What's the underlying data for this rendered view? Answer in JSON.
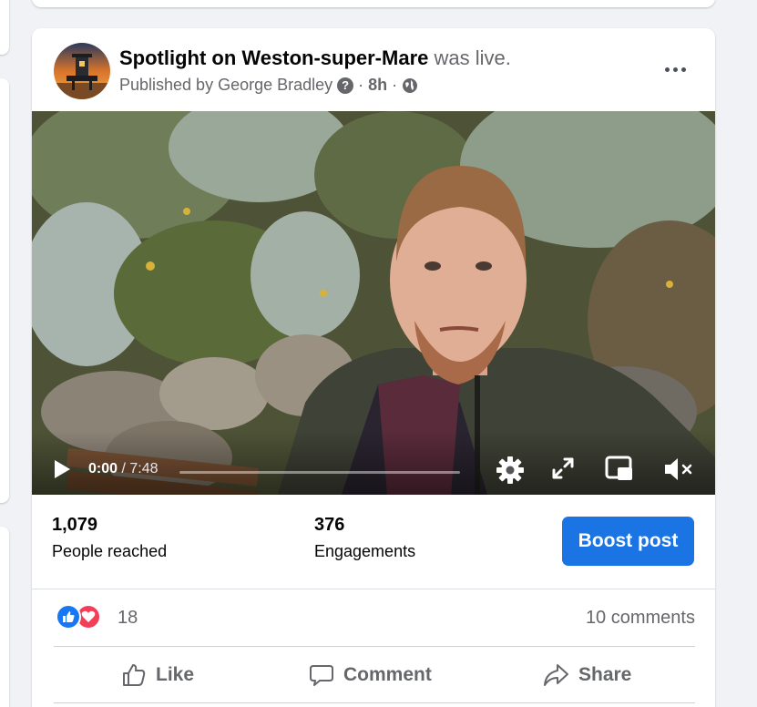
{
  "post": {
    "page_name": "Spotlight on Weston-super-Mare",
    "status_text": "was live.",
    "published_by": "Published by George Bradley",
    "info_icon": "question-circle-icon",
    "separator": "·",
    "time": "8h",
    "audience_icon": "globe-icon",
    "more_icon": "more-dots-icon"
  },
  "video": {
    "current_time": "0:00",
    "time_separator": "/",
    "duration": "7:48",
    "progress": 0,
    "icons": [
      "play-icon",
      "settings-gear-icon",
      "fullscreen-icon",
      "picture-in-picture-icon",
      "volume-muted-icon"
    ]
  },
  "stats": {
    "reached_value": "1,079",
    "reached_label": "People reached",
    "engagements_value": "376",
    "engagements_label": "Engagements",
    "boost_label": "Boost post"
  },
  "reactions": {
    "count": "18",
    "comments": "10 comments",
    "types": [
      "like",
      "love"
    ]
  },
  "actions": {
    "like": "Like",
    "comment": "Comment",
    "share": "Share"
  },
  "colors": {
    "primary": "#1b74e4",
    "like": "#1877f2",
    "love": "#f33e58",
    "secondary_text": "#65676b"
  }
}
